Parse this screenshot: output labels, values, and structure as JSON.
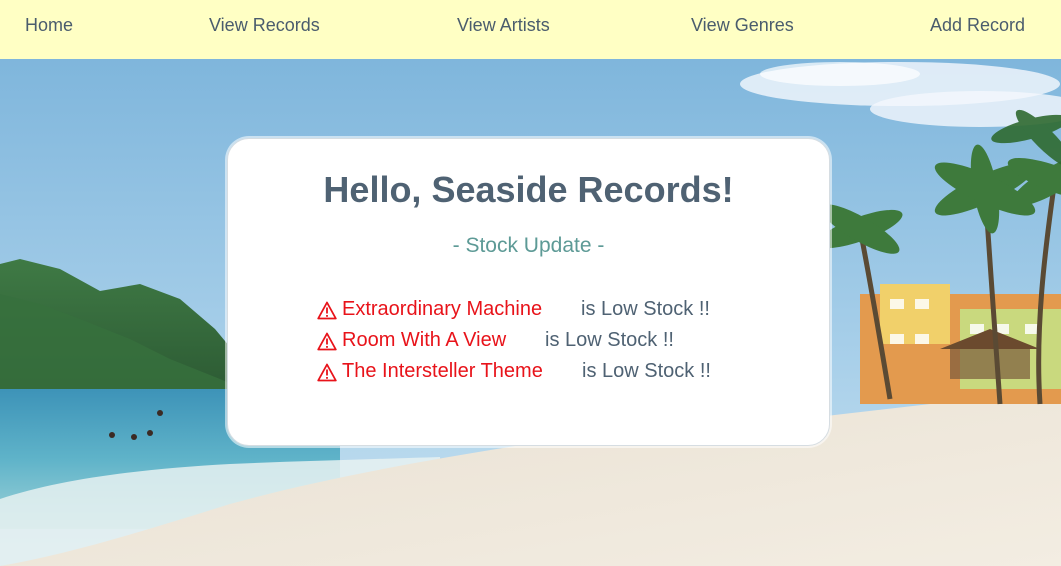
{
  "nav": {
    "home": "Home",
    "view_records": "View Records",
    "view_artists": "View Artists",
    "view_genres": "View Genres",
    "add_record": "Add Record"
  },
  "card": {
    "title": "Hello, Seaside Records!",
    "subtitle": "- Stock Update -",
    "alerts": [
      {
        "record": "Extraordinary Machine",
        "status": "is Low Stock !!"
      },
      {
        "record": "Room With A View",
        "status": "is Low Stock !!"
      },
      {
        "record": "The Intersteller Theme",
        "status": "is Low Stock !!"
      }
    ]
  },
  "colors": {
    "navbar_bg": "#ffffc4",
    "nav_text": "#4a5c6d",
    "title": "#4f6273",
    "subtitle": "#5d9a96",
    "alert_red": "#e8131a"
  },
  "icons": {
    "alert": "warning-triangle-icon"
  }
}
